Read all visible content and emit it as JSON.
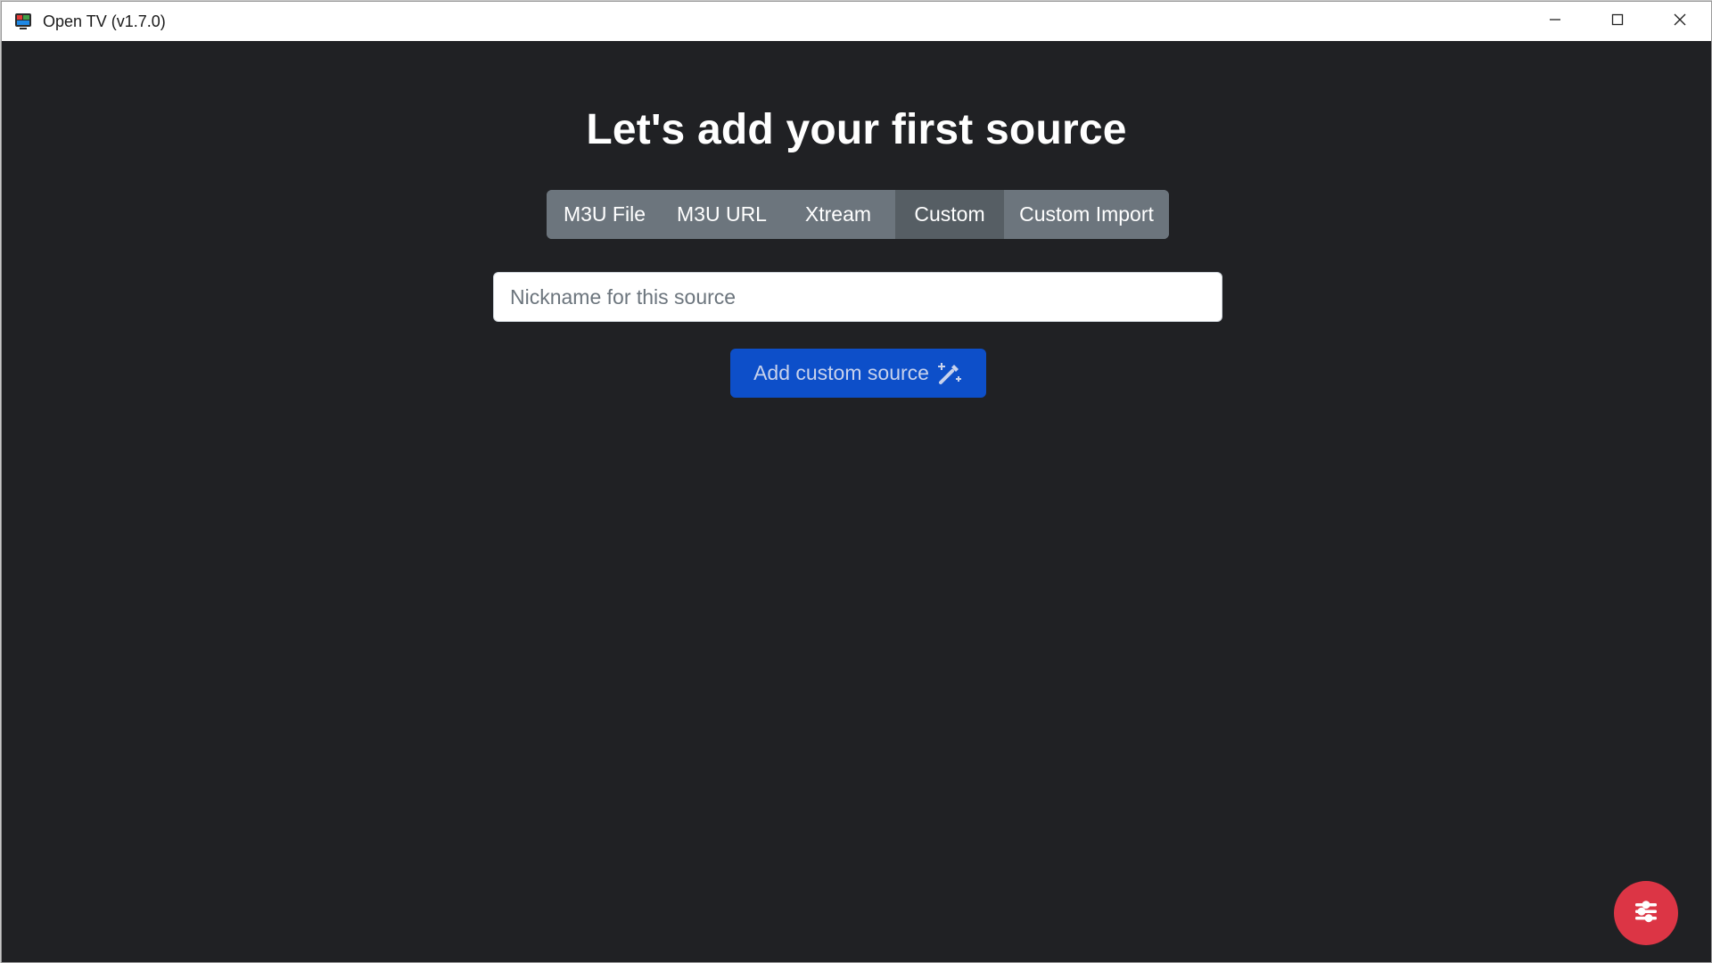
{
  "window": {
    "title": "Open TV (v1.7.0)",
    "icon": "tv-icon",
    "controls": [
      "minimize-icon",
      "maximize-icon",
      "close-icon"
    ]
  },
  "main": {
    "heading": "Let's add your first source",
    "tabs": [
      {
        "label": "M3U File",
        "active": false
      },
      {
        "label": "M3U URL",
        "active": false
      },
      {
        "label": "Xtream",
        "active": false
      },
      {
        "label": "Custom",
        "active": true
      },
      {
        "label": "Custom Import",
        "active": false
      }
    ],
    "nickname": {
      "placeholder": "Nickname for this source",
      "value": ""
    },
    "add_button": {
      "label": "Add custom source",
      "icon": "magic-wand-icon"
    }
  },
  "fab": {
    "icon": "settings-sliders-icon"
  },
  "colors": {
    "background": "#202124",
    "tab": "#6c757d",
    "tab_active": "#565e64",
    "primary": "#0d4fc9",
    "fab": "#dc3545"
  }
}
